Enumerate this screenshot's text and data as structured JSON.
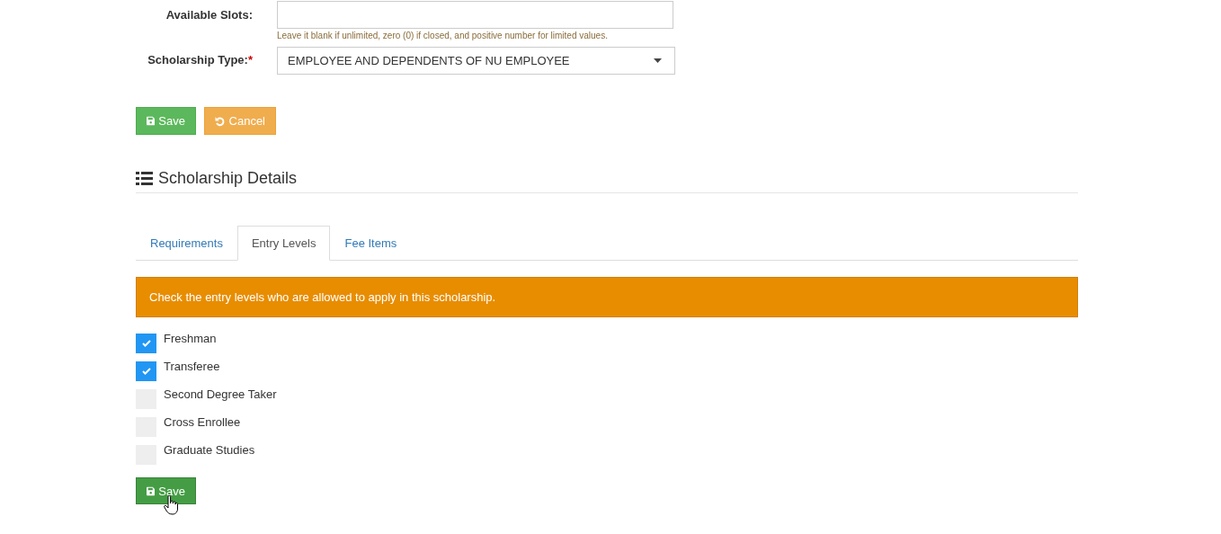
{
  "form": {
    "available_slots": {
      "label": "Available Slots:",
      "help": "Leave it blank if unlimited, zero (0) if closed, and positive number for limited values."
    },
    "scholarship_type": {
      "label": "Scholarship Type:",
      "required_mark": "*",
      "value": "EMPLOYEE AND DEPENDENTS OF NU EMPLOYEE"
    },
    "buttons": [
      {
        "kind": "save",
        "label": "Save"
      },
      {
        "kind": "cancel",
        "label": "Cancel"
      }
    ]
  },
  "details": {
    "heading": "Scholarship Details",
    "tabs": [
      {
        "label": "Requirements",
        "selected": false
      },
      {
        "label": "Entry Levels",
        "selected": true
      },
      {
        "label": "Fee Items",
        "selected": false
      }
    ],
    "alert": "Check the entry levels who are allowed to apply in this scholarship.",
    "entry_levels": [
      {
        "label": "Freshman",
        "checked": true
      },
      {
        "label": "Transferee",
        "checked": true
      },
      {
        "label": "Second Degree Taker",
        "checked": false
      },
      {
        "label": "Cross Enrollee",
        "checked": false
      },
      {
        "label": "Graduate Studies",
        "checked": false
      }
    ],
    "save_button": {
      "label": "Save"
    }
  }
}
